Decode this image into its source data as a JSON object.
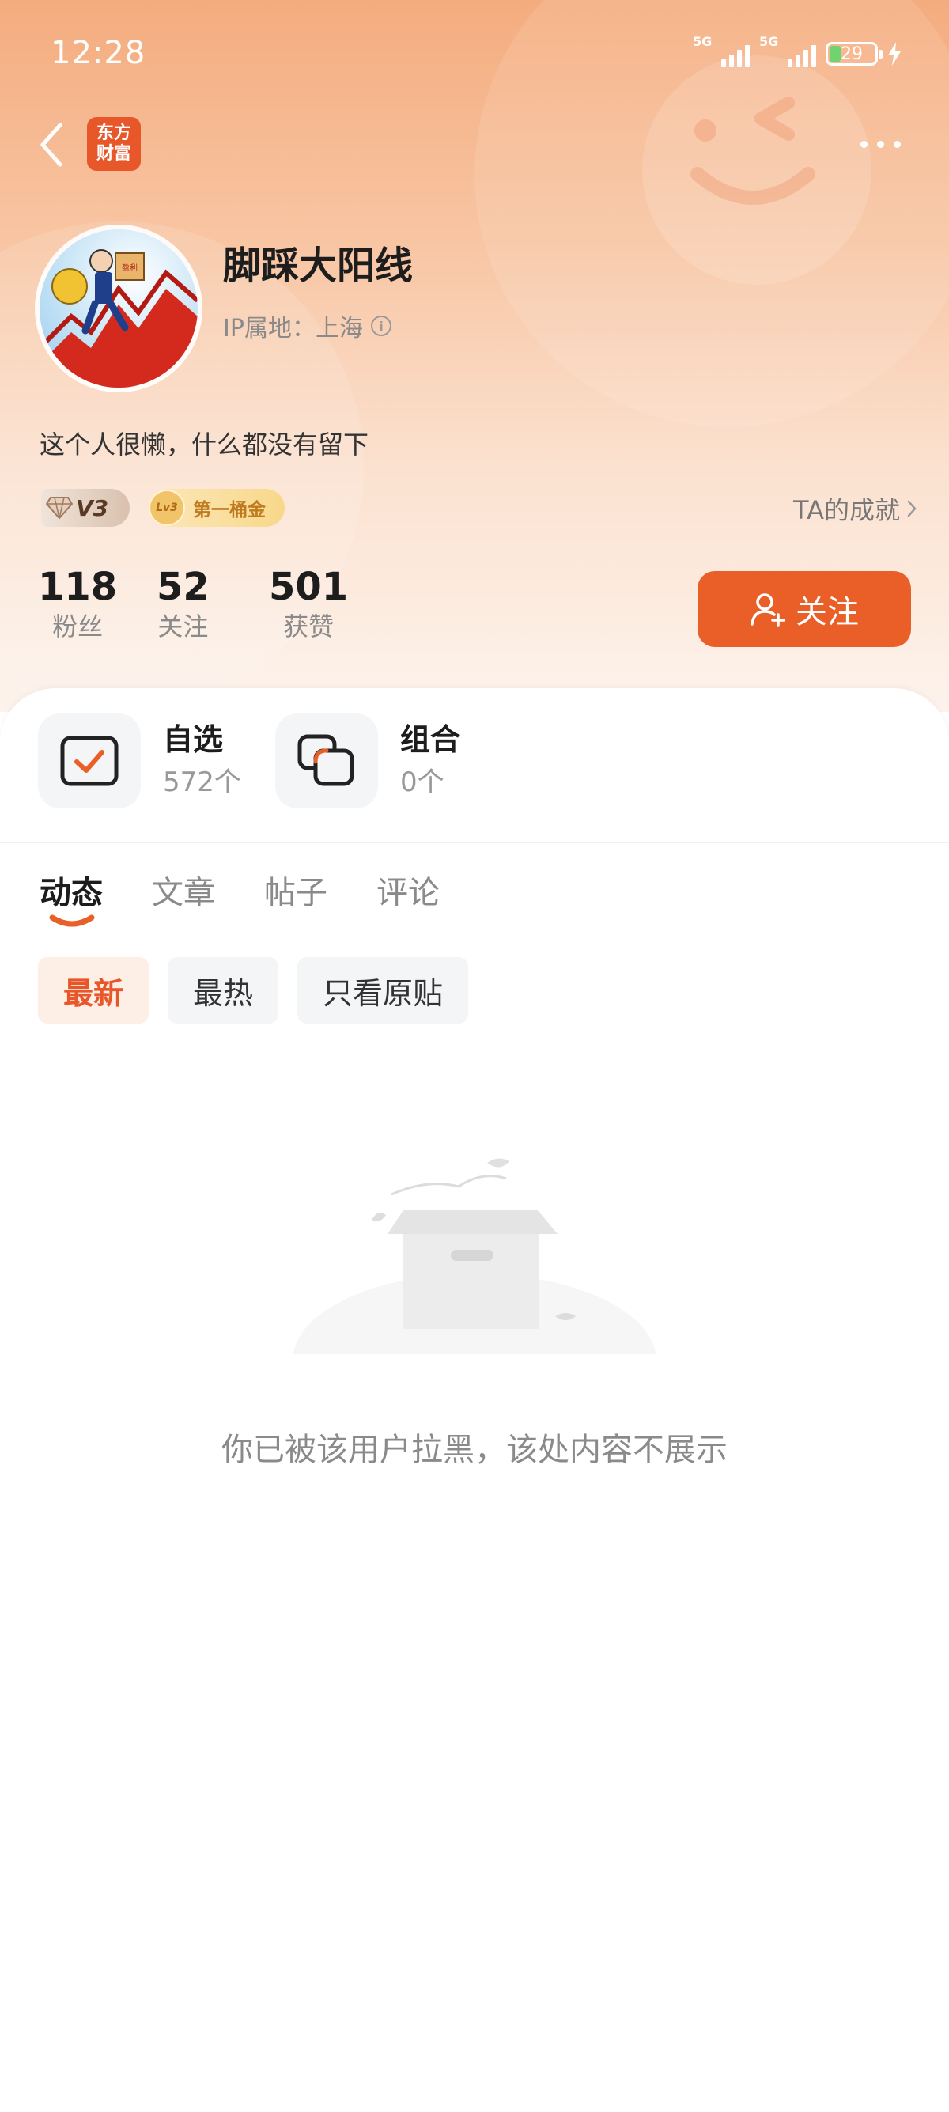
{
  "status_bar": {
    "time": "12:28",
    "network_1": "5G",
    "network_2": "5G",
    "battery": "29"
  },
  "app": {
    "logo_line1": "东方",
    "logo_line2": "财富"
  },
  "profile": {
    "username": "脚踩大阳线",
    "ip_label": "IP属地：上海",
    "bio": "这个人很懒，什么都没有留下",
    "vip_badge": "V3",
    "level_badge_code": "Lv3",
    "level_badge_title": "第一桶金",
    "achievements_link": "TA的成就",
    "avatar_badge_text": "盈利"
  },
  "stats": [
    {
      "value": "118",
      "label": "粉丝"
    },
    {
      "value": "52",
      "label": "关注"
    },
    {
      "value": "501",
      "label": "获赞"
    }
  ],
  "follow_button": {
    "label": "关注"
  },
  "quick_links": [
    {
      "title": "自选",
      "sub": "572个"
    },
    {
      "title": "组合",
      "sub": "0个"
    }
  ],
  "tabs": [
    {
      "label": "动态",
      "active": true
    },
    {
      "label": "文章",
      "active": false
    },
    {
      "label": "帖子",
      "active": false
    },
    {
      "label": "评论",
      "active": false
    }
  ],
  "filters": [
    {
      "label": "最新",
      "active": true
    },
    {
      "label": "最热",
      "active": false
    },
    {
      "label": "只看原贴",
      "active": false
    }
  ],
  "empty_state": {
    "message": "你已被该用户拉黑，该处内容不展示"
  },
  "colors": {
    "accent": "#EA5F28",
    "hero_top": "#F4AC7E",
    "text_muted": "#8A8A8A"
  }
}
